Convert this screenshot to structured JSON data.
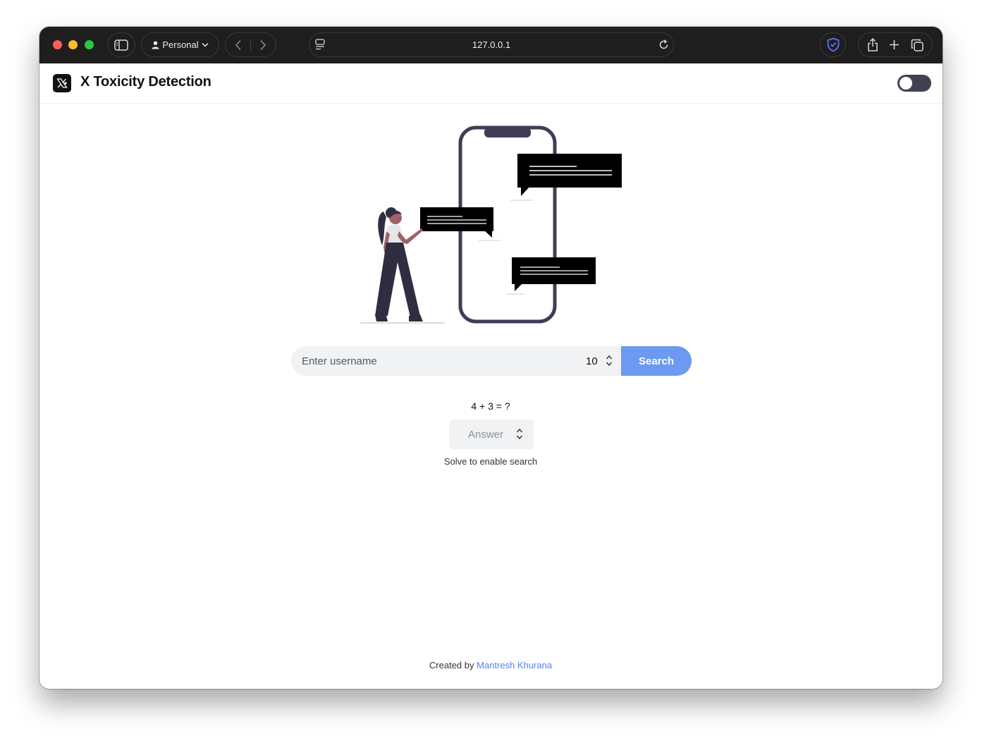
{
  "browser": {
    "profile_label": "Personal",
    "url": "127.0.0.1"
  },
  "app": {
    "title": "X Toxicity Detection",
    "theme_toggle_on": false
  },
  "search": {
    "placeholder": "Enter username",
    "count_value": "10",
    "button_label": "Search"
  },
  "captcha": {
    "question": "4 + 3 = ?",
    "answer_placeholder": "Answer",
    "hint": "Solve to enable search"
  },
  "footer": {
    "prefix": "Created by",
    "author": "Mantresh Khurana"
  },
  "colors": {
    "accent": "#6b9af0",
    "link": "#4f86e8",
    "toolbar": "#1e1e1e"
  }
}
